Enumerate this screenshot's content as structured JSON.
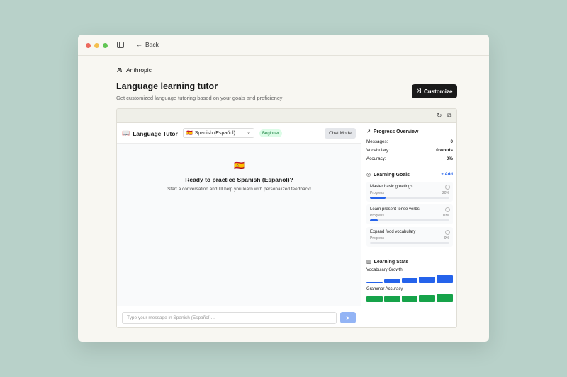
{
  "window": {
    "back_label": "Back"
  },
  "brand": {
    "name": "Anthropic",
    "logo_text": "A\\"
  },
  "header": {
    "title": "Language learning tutor",
    "subtitle": "Get customized language tutoring based on your goals and proficiency",
    "customize_label": "Customize"
  },
  "preview_toolbar": {
    "refresh_icon": "refresh-icon",
    "open_icon": "external-link-icon"
  },
  "chat": {
    "app_name": "Language Tutor",
    "language_flag": "🇪🇸",
    "language_selected": "Spanish (Español)",
    "level_badge": "Beginner",
    "mode_button": "Chat Mode",
    "empty_flag": "🇪🇸",
    "empty_title": "Ready to practice Spanish (Español)?",
    "empty_subtitle": "Start a conversation and I'll help you learn with personalized feedback!",
    "input_placeholder": "Type your message in Spanish (Español)...",
    "input_value": ""
  },
  "progress_overview": {
    "title": "Progress Overview",
    "rows": [
      {
        "label": "Messages:",
        "value": "0"
      },
      {
        "label": "Vocabulary:",
        "value": "0 words"
      },
      {
        "label": "Accuracy:",
        "value": "0%"
      }
    ]
  },
  "learning_goals": {
    "title": "Learning Goals",
    "add_label": "+ Add",
    "goals": [
      {
        "name": "Master basic greetings",
        "progress_label": "Progress",
        "percent_label": "20%",
        "progress": 0.2
      },
      {
        "name": "Learn present tense verbs",
        "progress_label": "Progress",
        "percent_label": "10%",
        "progress": 0.1
      },
      {
        "name": "Expand food vocabulary",
        "progress_label": "Progress",
        "percent_label": "0%",
        "progress": 0.0
      }
    ]
  },
  "learning_stats": {
    "title": "Learning Stats",
    "vocab_label": "Vocabulary Growth",
    "vocab_levels": [
      0.2,
      0.4,
      0.55,
      0.75,
      0.9
    ],
    "vocab_color": "#2563eb",
    "grammar_label": "Grammar Accuracy",
    "grammar_levels": [
      0.65,
      0.7,
      0.75,
      0.8,
      0.9
    ],
    "grammar_color": "#16a34a"
  },
  "colors": {
    "accent": "#2563eb",
    "success": "#16a34a",
    "badge_bg": "#dcfce7"
  }
}
